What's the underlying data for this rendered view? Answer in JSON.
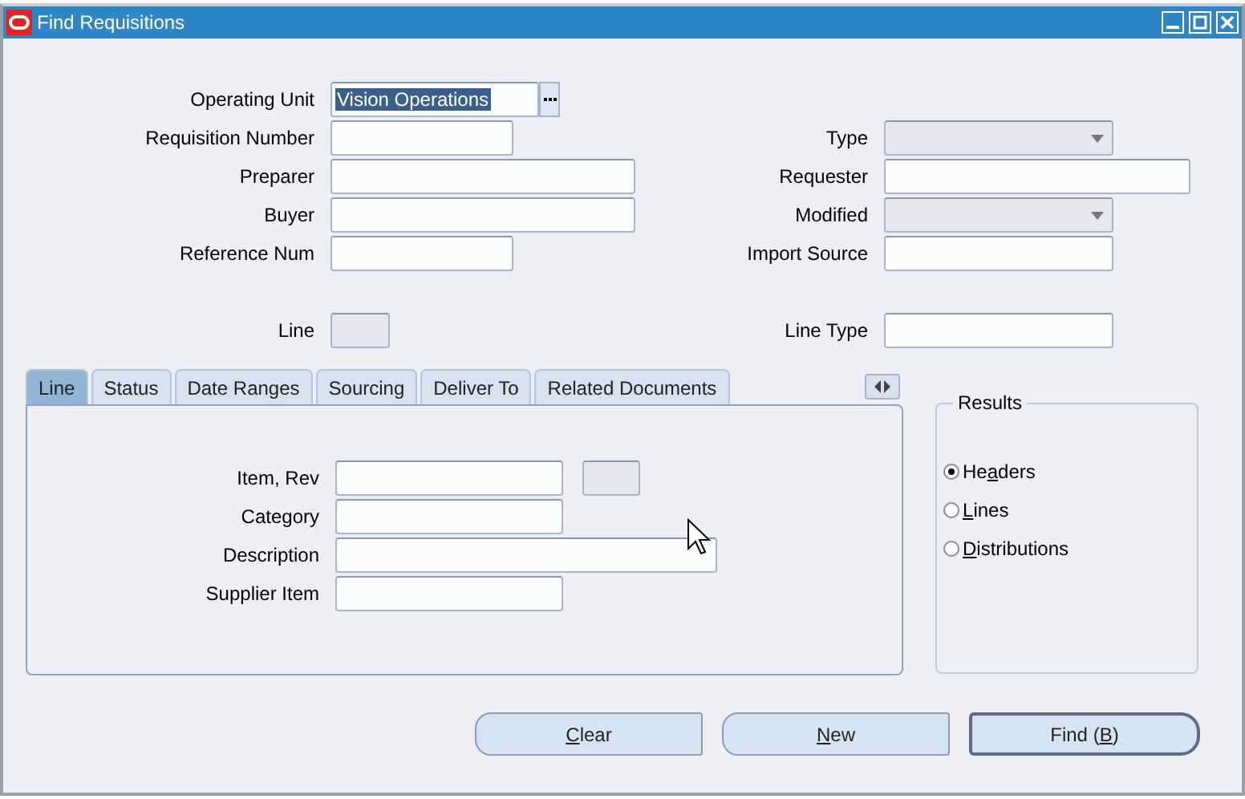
{
  "window": {
    "title": "Find Requisitions"
  },
  "fields_left": [
    {
      "label": "Operating Unit",
      "kind": "lov",
      "value": "Vision Operations",
      "text_selected": true,
      "disabled": false
    },
    {
      "label": "Requisition Number",
      "kind": "text",
      "disabled": false
    },
    {
      "label": "Preparer",
      "kind": "text",
      "disabled": false
    },
    {
      "label": "Buyer",
      "kind": "text",
      "disabled": false
    },
    {
      "label": "Reference Num",
      "kind": "text",
      "disabled": false
    },
    {
      "label": "Line",
      "kind": "text",
      "disabled": true
    }
  ],
  "fields_right": [
    {
      "label": "Type",
      "kind": "select",
      "disabled": true
    },
    {
      "label": "Requester",
      "kind": "text",
      "disabled": false
    },
    {
      "label": "Modified",
      "kind": "select",
      "disabled": true
    },
    {
      "label": "Import Source",
      "kind": "text",
      "disabled": false
    },
    {
      "label": "Line Type",
      "kind": "text",
      "disabled": false
    }
  ],
  "tabs": [
    {
      "label": "Line",
      "selected": true
    },
    {
      "label": "Status",
      "selected": false
    },
    {
      "label": "Date Ranges",
      "selected": false
    },
    {
      "label": "Sourcing",
      "selected": false
    },
    {
      "label": "Deliver To",
      "selected": false
    },
    {
      "label": "Related Documents",
      "selected": false
    }
  ],
  "line_fields": [
    {
      "label": "Item, Rev",
      "disabled": false,
      "extra_disabled": true
    },
    {
      "label": "Category",
      "disabled": false
    },
    {
      "label": "Description",
      "disabled": false
    },
    {
      "label": "Supplier Item",
      "disabled": false
    }
  ],
  "results": {
    "title": "Results",
    "options": [
      {
        "label_parts": {
          "before": "He",
          "key": "a",
          "after": "ders"
        },
        "selected": true
      },
      {
        "label_parts": {
          "key": "L",
          "after": "ines"
        },
        "selected": false
      },
      {
        "label_parts": {
          "key": "D",
          "after": "istributions"
        },
        "selected": false
      }
    ]
  },
  "buttons": [
    {
      "label_parts": {
        "key": "C",
        "after": "lear"
      },
      "default": false
    },
    {
      "label_parts": {
        "key": "N",
        "after": "ew"
      },
      "default": false
    },
    {
      "label_parts": {
        "before": "Find (",
        "key": "B",
        "after": ")"
      },
      "default": true
    }
  ]
}
